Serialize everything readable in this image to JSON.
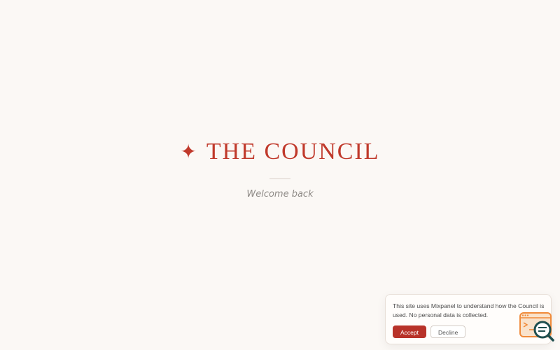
{
  "app": {
    "name": "THE COUNCIL",
    "star_glyph": "✦"
  },
  "welcome": {
    "text": "Welcome back"
  },
  "consent": {
    "message": "This site uses Mixpanel to understand how the Council is used. No personal data is collected.",
    "accept_label": "Accept",
    "decline_label": "Decline"
  },
  "colors": {
    "background": "#fbf8f5",
    "brand": "#c0392b",
    "accept": "#b83229"
  },
  "icons": {
    "brand_mark": "four-point-star-icon",
    "widget": "search-chat-icon"
  }
}
